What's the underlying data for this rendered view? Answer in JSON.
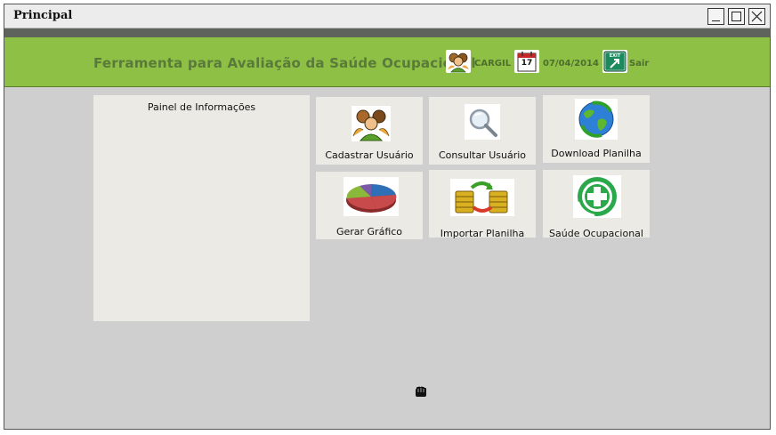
{
  "window": {
    "title": "Principal"
  },
  "header": {
    "app_title": "Ferramenta para Avaliação da Saúde Ocupacional",
    "user_label": "CARGIL",
    "calendar_day": "17",
    "date": "07/04/2014",
    "exit_sign": "EXIT",
    "exit_label": "Sair"
  },
  "info_panel": {
    "title": "Painel de Informações"
  },
  "tiles": [
    {
      "label": "Cadastrar Usuário",
      "icon": "users-icon"
    },
    {
      "label": "Consultar Usuário",
      "icon": "magnifier-icon"
    },
    {
      "label": "Download Planilha",
      "icon": "globe-icon"
    },
    {
      "label": "Gerar Gráfico",
      "icon": "pie-chart-icon"
    },
    {
      "label": "Importar Planilha",
      "icon": "coins-transfer-icon"
    },
    {
      "label": "Saúde Ocupacional",
      "icon": "health-cross-icon"
    }
  ],
  "colors": {
    "header_green": "#8dc044",
    "title_green": "#5a7a3a",
    "panel_bg": "#eceae4",
    "window_bg": "#cfcfcf",
    "band_dark": "#5e635c"
  }
}
